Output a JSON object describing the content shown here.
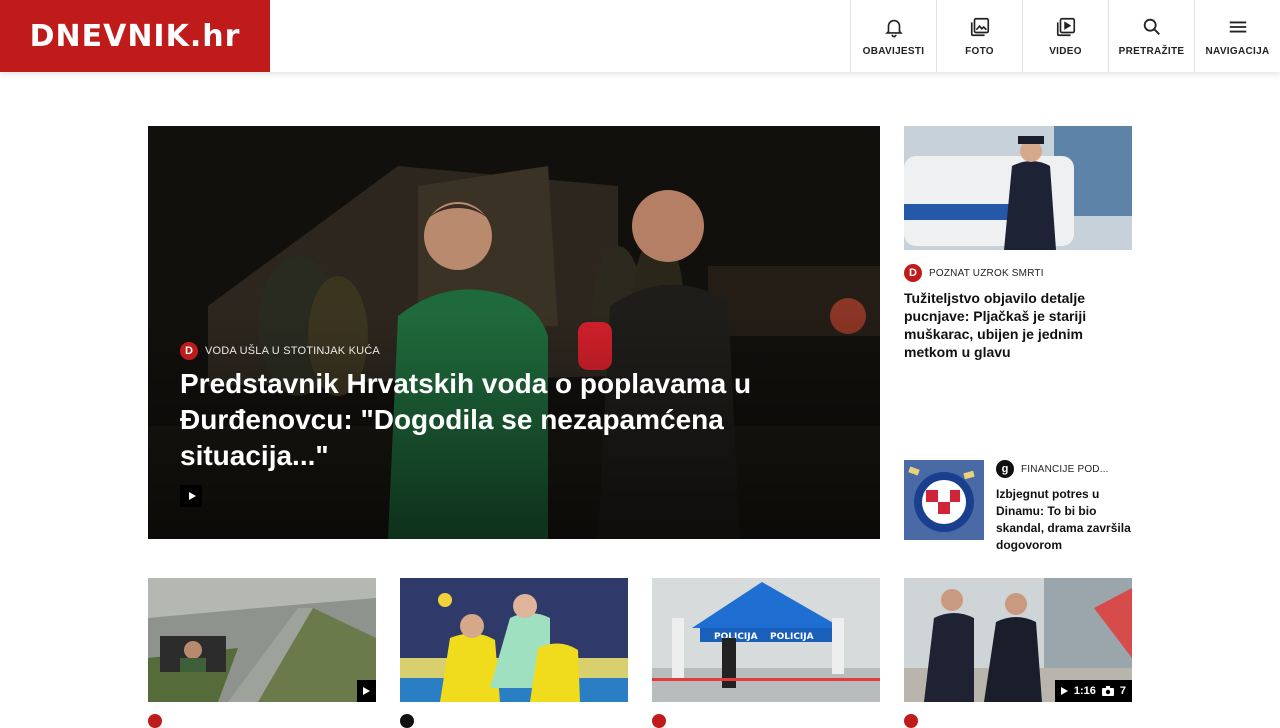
{
  "header": {
    "logo": "DNEVNIK.hr",
    "nav": [
      {
        "label": "OBAVIJESTI",
        "icon": "bell-icon"
      },
      {
        "label": "FOTO",
        "icon": "photo-icon"
      },
      {
        "label": "VIDEO",
        "icon": "video-icon"
      },
      {
        "label": "PRETRAŽITE",
        "icon": "search-icon"
      },
      {
        "label": "NAVIGACIJA",
        "icon": "menu-icon"
      }
    ]
  },
  "hero": {
    "badge": "D",
    "tag": "VODA UŠLA U STOTINJAK KUĆA",
    "title": "Predstavnik Hrvatskih voda o poplavama u Đurđenovcu: \"Dogodila se nezapamćena situacija...\""
  },
  "side": [
    {
      "badge": "D",
      "tag": "POZNAT UZROK SMRTI",
      "title": "Tužiteljstvo objavilo detalje pucnjave: Pljačkaš je stariji muškarac, ubijen je jednim metkom u glavu"
    },
    {
      "badge": "g",
      "tag": "FINANCIJE POD...",
      "title": "Izbjegnut potres u Dinamu: To bi bio skandal, drama završila dogovorom"
    }
  ],
  "cards": [
    {
      "media": "video"
    },
    {
      "media": "none"
    },
    {
      "media": "none"
    },
    {
      "media": "gallery",
      "duration": "1:16",
      "photo_count": "7"
    }
  ],
  "colors": {
    "brand": "#c01b1b"
  }
}
